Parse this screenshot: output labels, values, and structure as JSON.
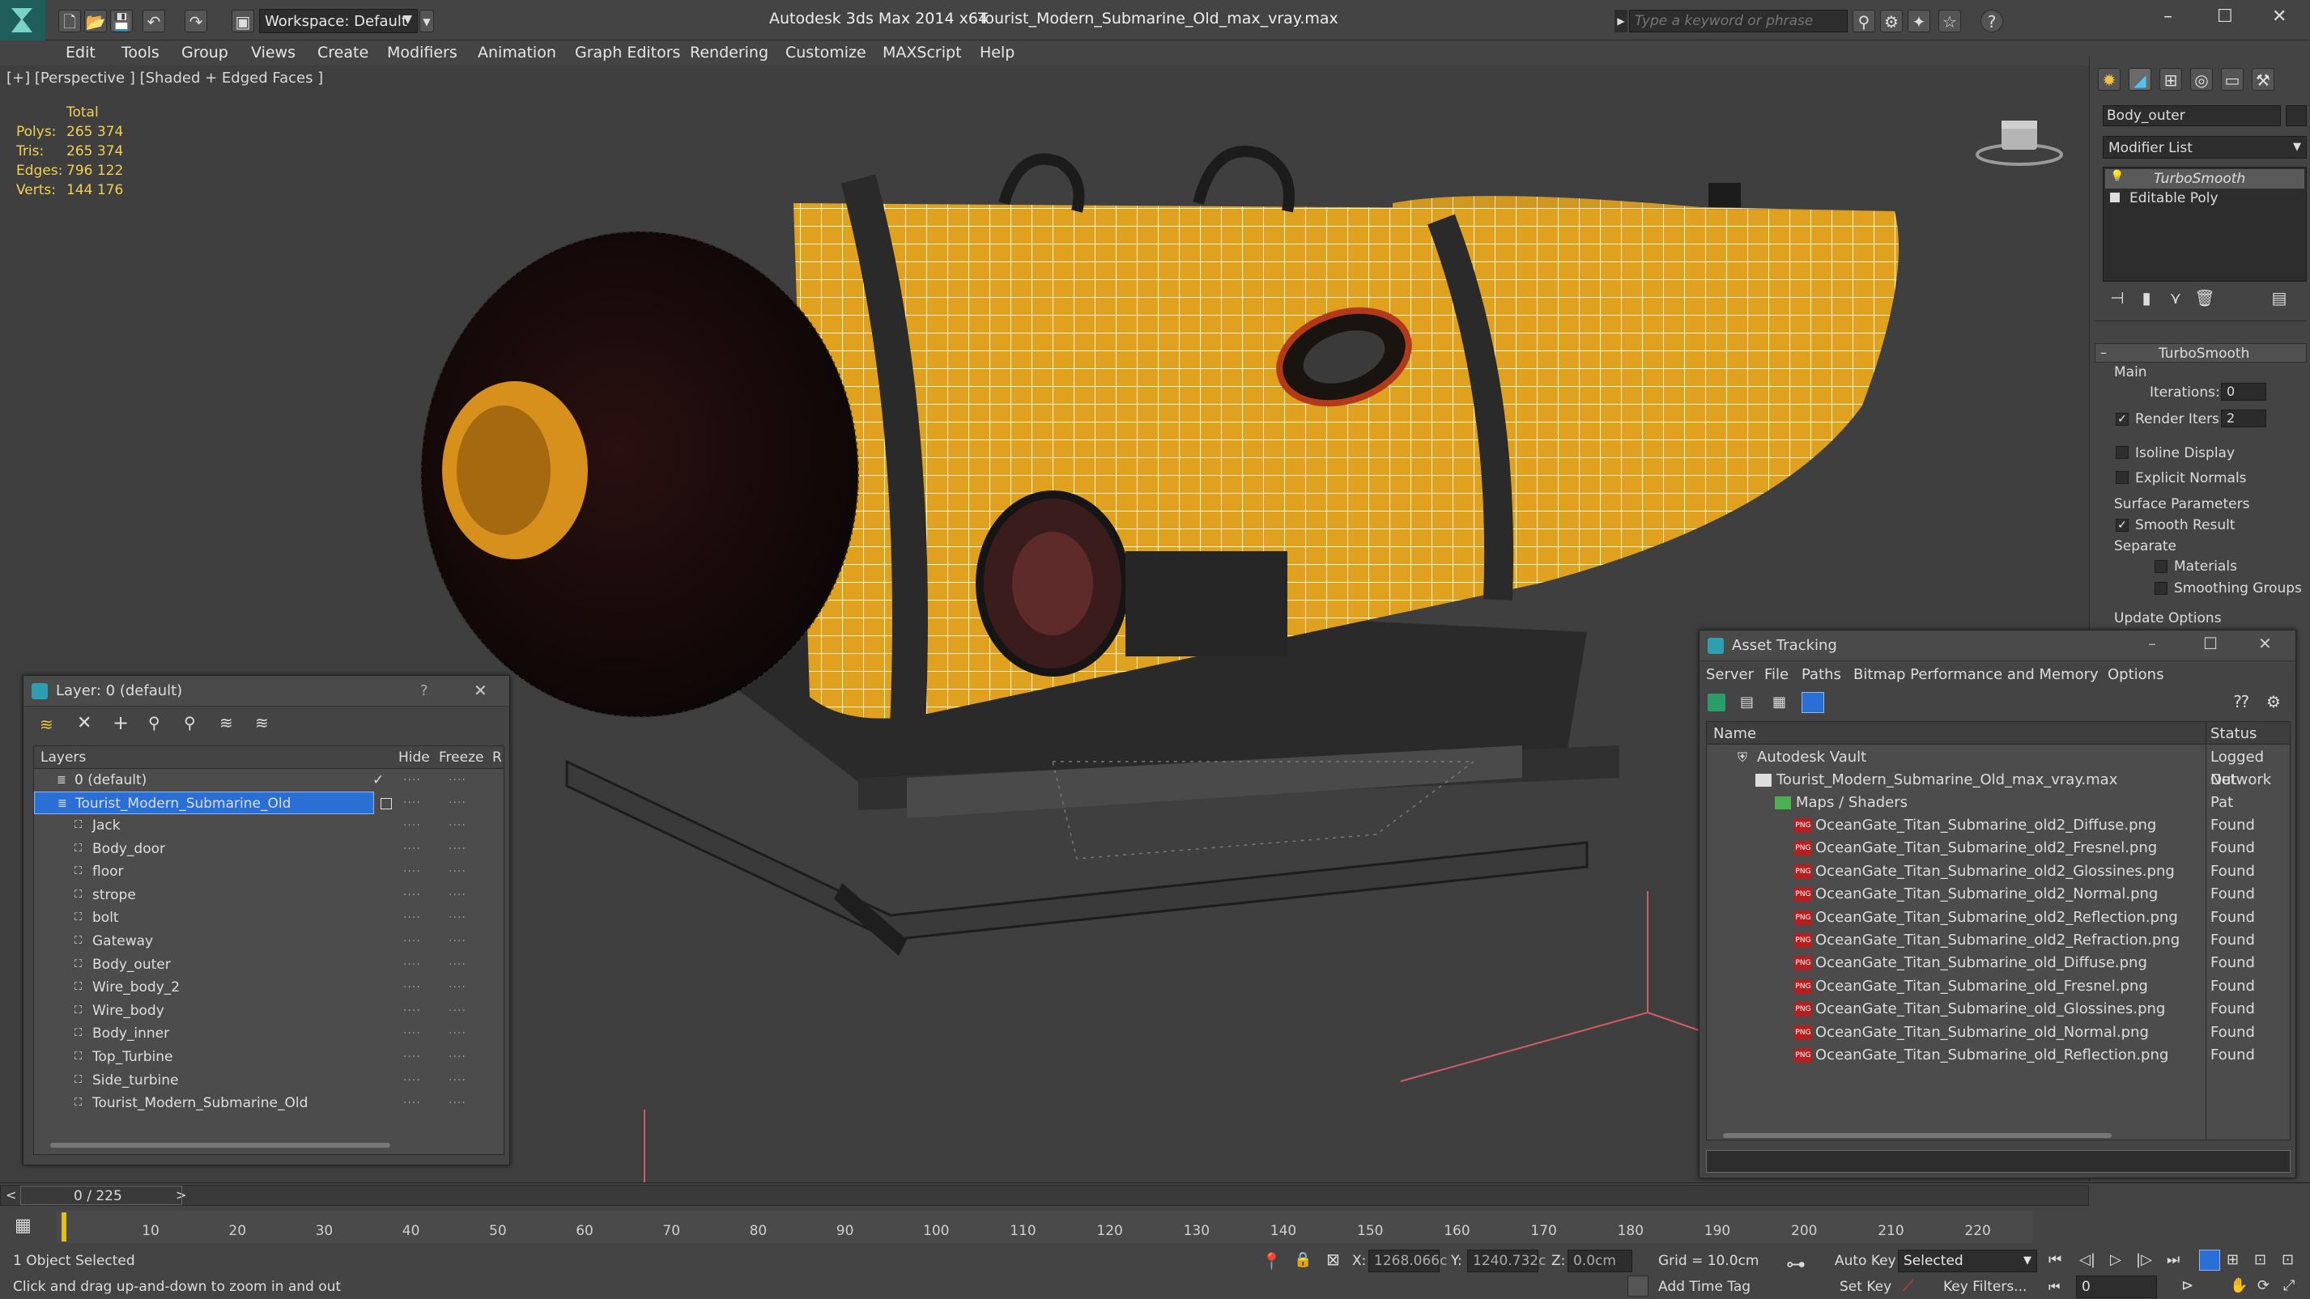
{
  "titlebar": {
    "workspace_label": "Workspace: Default",
    "app_title": "Autodesk 3ds Max  2014 x64",
    "file_title": "Tourist_Modern_Submarine_Old_max_vray.max",
    "search_placeholder": "Type a keyword or phrase",
    "help_glyph": "?",
    "minimize_glyph": "–",
    "maximize_glyph": "☐",
    "close_glyph": "✕"
  },
  "menu": [
    "Edit",
    "Tools",
    "Group",
    "Views",
    "Create",
    "Modifiers",
    "Animation",
    "Graph Editors",
    "Rendering",
    "Customize",
    "MAXScript",
    "Help"
  ],
  "viewport": {
    "label": "[+] [Perspective ] [Shaded + Edged Faces ]",
    "stats": {
      "header": "Total",
      "rows": [
        {
          "label": "Polys:",
          "value": "265 374"
        },
        {
          "label": "Tris:",
          "value": "265 374"
        },
        {
          "label": "Edges:",
          "value": "796 122"
        },
        {
          "label": "Verts:",
          "value": "144 176"
        }
      ]
    }
  },
  "command_panel": {
    "object_name": "Body_outer",
    "modifier_list": "Modifier List",
    "stack": [
      "TurboSmooth",
      "Editable Poly"
    ],
    "rollout_title": "TurboSmooth",
    "main_label": "Main",
    "iterations_label": "Iterations:",
    "iterations_value": "0",
    "render_iters_label": "Render Iters:",
    "render_iters_value": "2",
    "isoline_label": "Isoline Display",
    "explicit_normals_label": "Explicit Normals",
    "surface_params_label": "Surface Parameters",
    "smooth_result_label": "Smooth Result",
    "separate_label": "Separate",
    "materials_label": "Materials",
    "smoothing_groups_label": "Smoothing Groups",
    "update_options_label": "Update Options"
  },
  "layer_dialog": {
    "title": "Layer: 0 (default)",
    "help_glyph": "?",
    "close_glyph": "✕",
    "columns": [
      "Layers",
      "Hide",
      "Freeze",
      "R"
    ],
    "layers": [
      "0 (default)",
      "Tourist_Modern_Submarine_Old"
    ],
    "objects": [
      "Jack",
      "Body_door",
      "floor",
      "strope",
      "bolt",
      "Gateway",
      "Body_outer",
      "Wire_body_2",
      "Wire_body",
      "Body_inner",
      "Top_Turbine",
      "Side_turbine",
      "Tourist_Modern_Submarine_Old"
    ]
  },
  "asset_dialog": {
    "title": "Asset Tracking",
    "menu": [
      "Server",
      "File",
      "Paths",
      "Bitmap Performance and Memory",
      "Options"
    ],
    "columns": [
      "Name",
      "Status"
    ],
    "vault": {
      "name": "Autodesk Vault",
      "status": "Logged Out"
    },
    "file": {
      "name": "Tourist_Modern_Submarine_Old_max_vray.max",
      "status": "Network Pat"
    },
    "group": "Maps / Shaders",
    "maps": [
      {
        "name": "OceanGate_Titan_Submarine_old2_Diffuse.png",
        "status": "Found"
      },
      {
        "name": "OceanGate_Titan_Submarine_old2_Fresnel.png",
        "status": "Found"
      },
      {
        "name": "OceanGate_Titan_Submarine_old2_Glossines.png",
        "status": "Found"
      },
      {
        "name": "OceanGate_Titan_Submarine_old2_Normal.png",
        "status": "Found"
      },
      {
        "name": "OceanGate_Titan_Submarine_old2_Reflection.png",
        "status": "Found"
      },
      {
        "name": "OceanGate_Titan_Submarine_old2_Refraction.png",
        "status": "Found"
      },
      {
        "name": "OceanGate_Titan_Submarine_old_Diffuse.png",
        "status": "Found"
      },
      {
        "name": "OceanGate_Titan_Submarine_old_Fresnel.png",
        "status": "Found"
      },
      {
        "name": "OceanGate_Titan_Submarine_old_Glossines.png",
        "status": "Found"
      },
      {
        "name": "OceanGate_Titan_Submarine_old_Normal.png",
        "status": "Found"
      },
      {
        "name": "OceanGate_Titan_Submarine_old_Reflection.png",
        "status": "Found"
      }
    ],
    "png_badge": "PNG"
  },
  "timeline": {
    "frame_counter": "0 / 225",
    "ticks": [
      "10",
      "20",
      "30",
      "40",
      "50",
      "60",
      "70",
      "80",
      "90",
      "100",
      "110",
      "120",
      "130",
      "140",
      "150",
      "160",
      "170",
      "180",
      "190",
      "200",
      "210",
      "220"
    ],
    "status_selected": "1 Object Selected",
    "prompt": "Click and drag up-and-down to zoom in and out",
    "x_label": "X:",
    "x_value": "1268.066c",
    "y_label": "Y:",
    "y_value": "1240.732c",
    "z_label": "Z:",
    "z_value": "0.0cm",
    "grid": "Grid = 10.0cm",
    "auto_key": "Auto Key",
    "selected_value": "Selected",
    "set_key": "Set Key",
    "key_filters": "Key Filters...",
    "add_time_tag": "Add Time Tag",
    "frame_value": "0"
  },
  "colors": {
    "selection": "#2a6fd6",
    "accent_yellow": "#e3a51c",
    "stats": "#f0d050"
  }
}
